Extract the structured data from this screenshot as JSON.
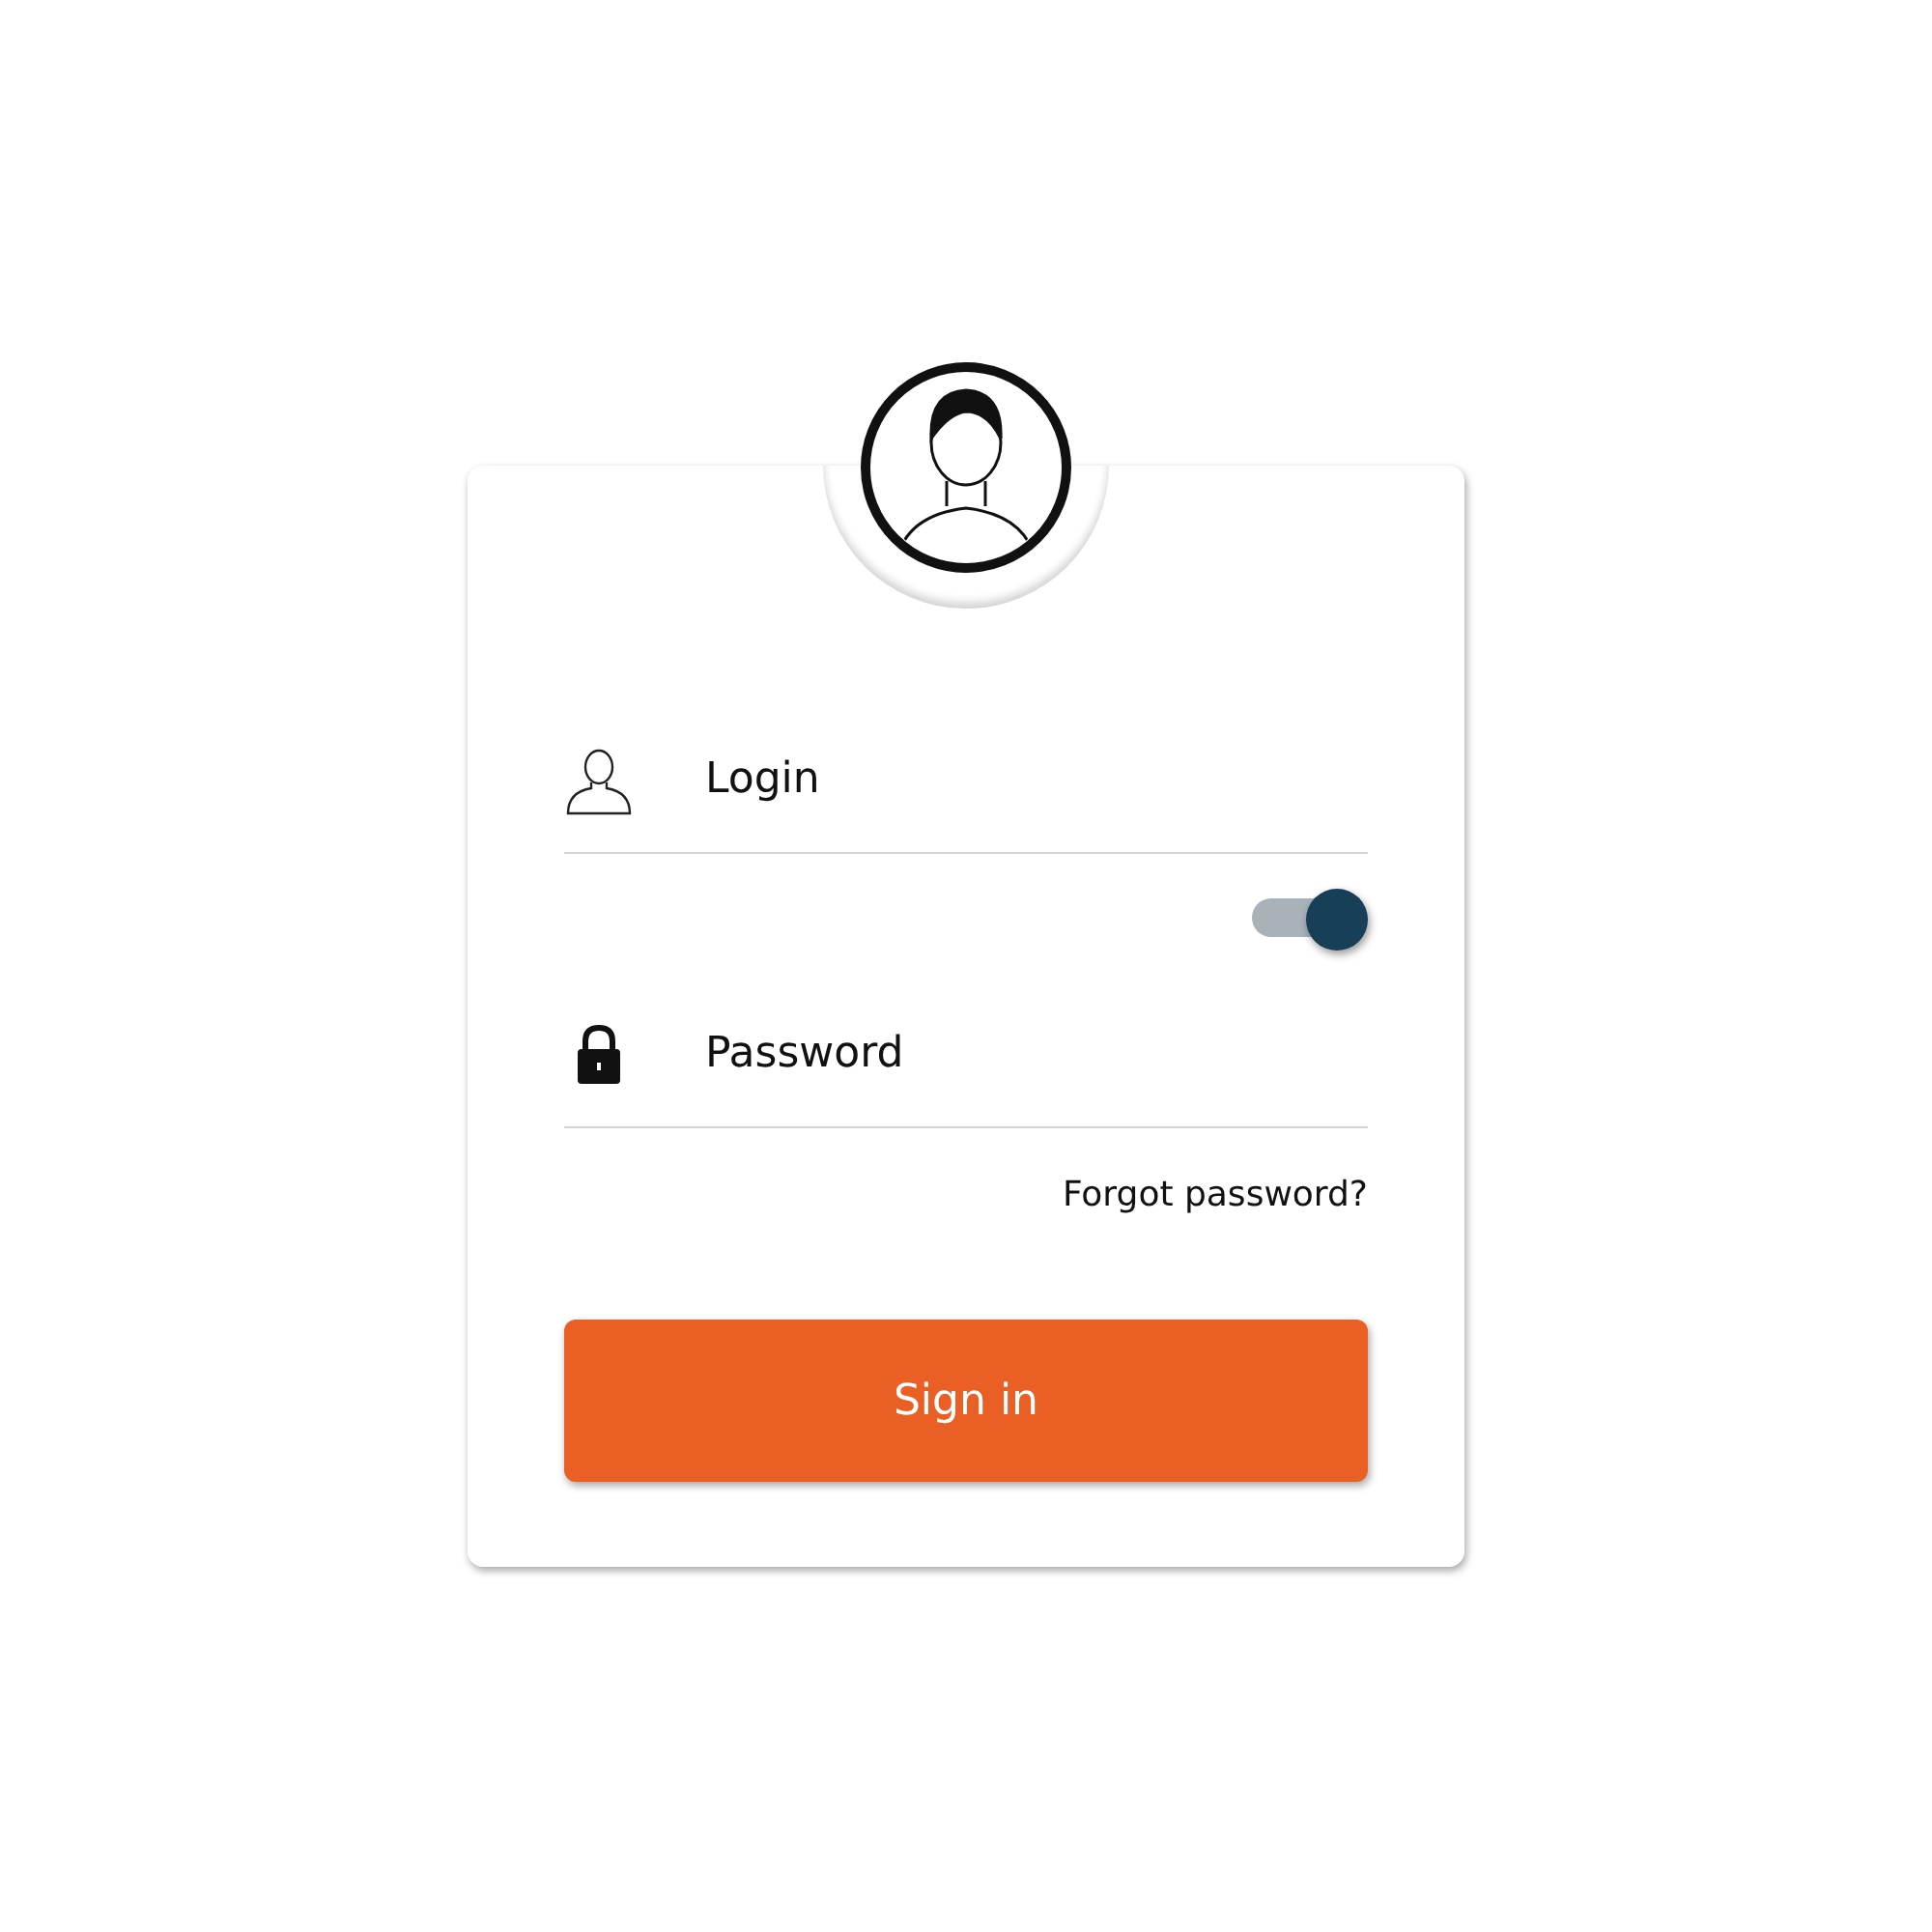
{
  "login_form": {
    "username": {
      "placeholder": "Login"
    },
    "toggle": {
      "on": true
    },
    "password": {
      "placeholder": "Password"
    },
    "forgot_link": "Forgot password?",
    "submit_button": "Sign in"
  }
}
